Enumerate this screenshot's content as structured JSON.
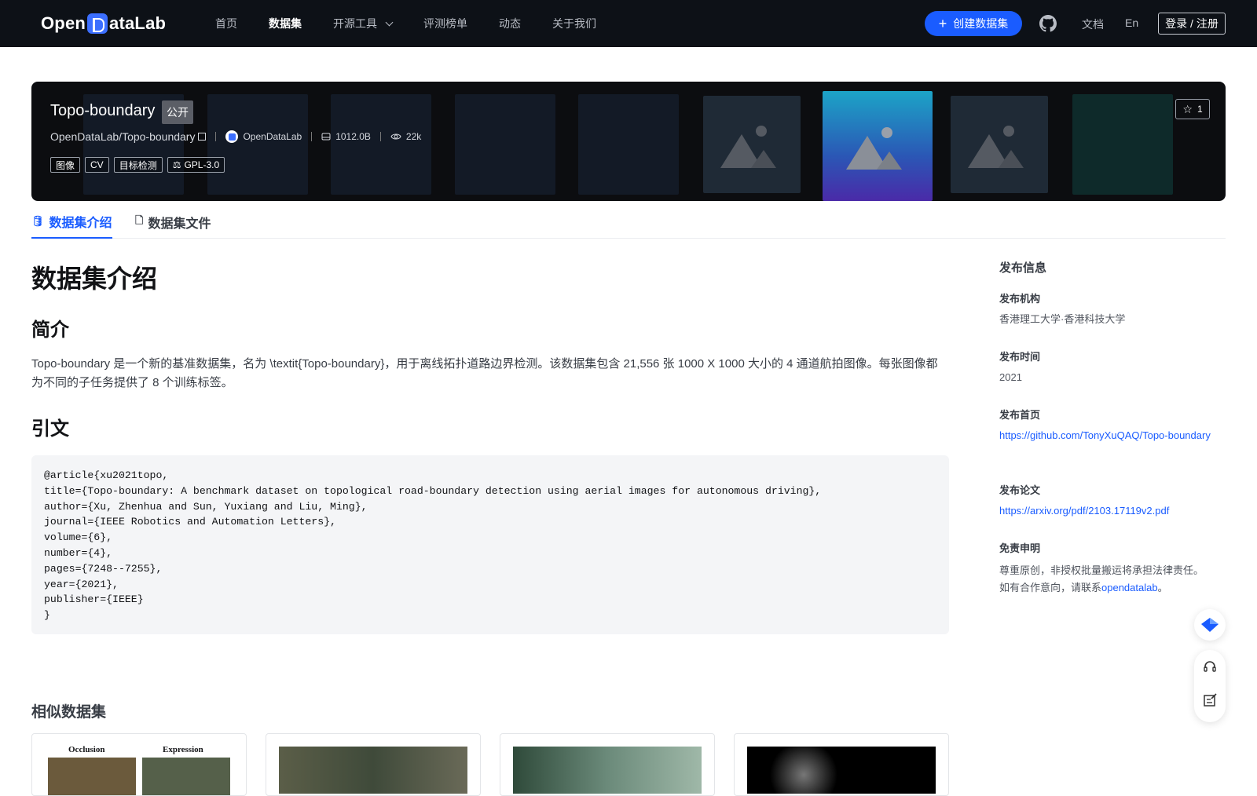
{
  "nav": {
    "logo": "OpenDataLab",
    "links": [
      "首页",
      "数据集",
      "开源工具",
      "评测榜单",
      "动态",
      "关于我们"
    ],
    "create_label": "创建数据集",
    "docs": "文档",
    "lang": "En",
    "login": "登录 / 注册"
  },
  "banner": {
    "title": "Topo-boundary",
    "visibility": "公开",
    "path": "OpenDataLab/Topo-boundary",
    "org": "OpenDataLab",
    "size": "1012.0B",
    "views": "22k",
    "tags": [
      "图像",
      "CV",
      "目标检测"
    ],
    "license": "GPL-3.0",
    "stars": "1"
  },
  "tabs": [
    "数据集介绍",
    "数据集文件"
  ],
  "main": {
    "heading": "数据集介绍",
    "intro_heading": "简介",
    "intro_text": "Topo-boundary 是一个新的基准数据集，名为 \\textit{Topo-boundary}，用于离线拓扑道路边界检测。该数据集包含 21,556 张 1000 X 1000 大小的 4 通道航拍图像。每张图像都为不同的子任务提供了 8 个训练标签。",
    "citation_heading": "引文",
    "citation": "@article{xu2021topo,\ntitle={Topo-boundary: A benchmark dataset on topological road-boundary detection using aerial images for autonomous driving},\nauthor={Xu, Zhenhua and Sun, Yuxiang and Liu, Ming},\njournal={IEEE Robotics and Automation Letters},\nvolume={6},\nnumber={4},\npages={7248--7255},\nyear={2021},\npublisher={IEEE}\n}",
    "similar_heading": "相似数据集"
  },
  "sidebar": {
    "title": "发布信息",
    "org_label": "发布机构",
    "org_value": "香港理工大学·香港科技大学",
    "time_label": "发布时间",
    "time_value": "2021",
    "home_label": "发布首页",
    "home_value": "https://github.com/TonyXuQAQ/Topo-boundary",
    "paper_label": "发布论文",
    "paper_value": "https://arxiv.org/pdf/2103.17119v2.pdf",
    "disclaimer_label": "免责申明",
    "disclaimer_line1": "尊重原创，非授权批量搬运将承担法律责任。",
    "disclaimer_line2_prefix": "如有合作意向，请联系",
    "disclaimer_link": "opendatalab",
    "disclaimer_suffix": "。"
  },
  "similar_cards": [
    {
      "caption_left": "Occlusion",
      "caption_right": "Expression"
    },
    {
      "caption_left": "",
      "caption_right": ""
    },
    {
      "caption_left": "",
      "caption_right": ""
    },
    {
      "caption_left": "",
      "caption_right": ""
    }
  ]
}
